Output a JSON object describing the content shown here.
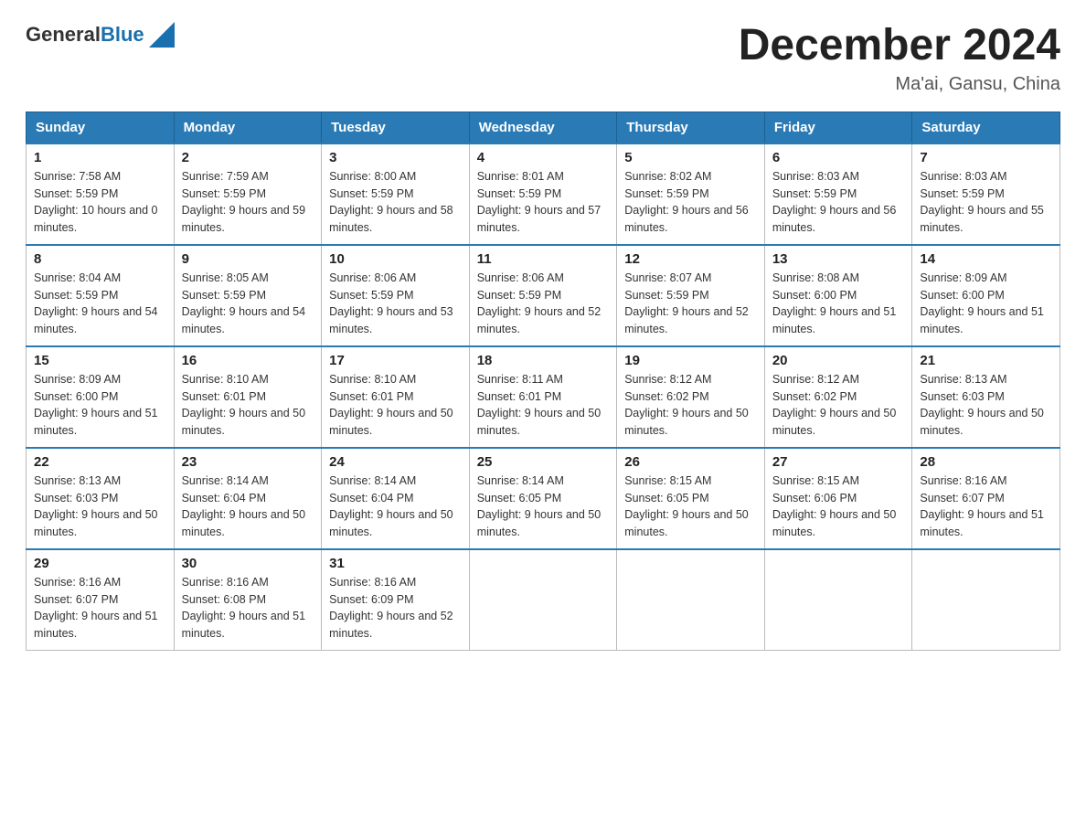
{
  "header": {
    "logo_general": "General",
    "logo_blue": "Blue",
    "month_title": "December 2024",
    "location": "Ma'ai, Gansu, China"
  },
  "days_of_week": [
    "Sunday",
    "Monday",
    "Tuesday",
    "Wednesday",
    "Thursday",
    "Friday",
    "Saturday"
  ],
  "weeks": [
    [
      {
        "day": "1",
        "sunrise": "7:58 AM",
        "sunset": "5:59 PM",
        "daylight": "10 hours and 0 minutes."
      },
      {
        "day": "2",
        "sunrise": "7:59 AM",
        "sunset": "5:59 PM",
        "daylight": "9 hours and 59 minutes."
      },
      {
        "day": "3",
        "sunrise": "8:00 AM",
        "sunset": "5:59 PM",
        "daylight": "9 hours and 58 minutes."
      },
      {
        "day": "4",
        "sunrise": "8:01 AM",
        "sunset": "5:59 PM",
        "daylight": "9 hours and 57 minutes."
      },
      {
        "day": "5",
        "sunrise": "8:02 AM",
        "sunset": "5:59 PM",
        "daylight": "9 hours and 56 minutes."
      },
      {
        "day": "6",
        "sunrise": "8:03 AM",
        "sunset": "5:59 PM",
        "daylight": "9 hours and 56 minutes."
      },
      {
        "day": "7",
        "sunrise": "8:03 AM",
        "sunset": "5:59 PM",
        "daylight": "9 hours and 55 minutes."
      }
    ],
    [
      {
        "day": "8",
        "sunrise": "8:04 AM",
        "sunset": "5:59 PM",
        "daylight": "9 hours and 54 minutes."
      },
      {
        "day": "9",
        "sunrise": "8:05 AM",
        "sunset": "5:59 PM",
        "daylight": "9 hours and 54 minutes."
      },
      {
        "day": "10",
        "sunrise": "8:06 AM",
        "sunset": "5:59 PM",
        "daylight": "9 hours and 53 minutes."
      },
      {
        "day": "11",
        "sunrise": "8:06 AM",
        "sunset": "5:59 PM",
        "daylight": "9 hours and 52 minutes."
      },
      {
        "day": "12",
        "sunrise": "8:07 AM",
        "sunset": "5:59 PM",
        "daylight": "9 hours and 52 minutes."
      },
      {
        "day": "13",
        "sunrise": "8:08 AM",
        "sunset": "6:00 PM",
        "daylight": "9 hours and 51 minutes."
      },
      {
        "day": "14",
        "sunrise": "8:09 AM",
        "sunset": "6:00 PM",
        "daylight": "9 hours and 51 minutes."
      }
    ],
    [
      {
        "day": "15",
        "sunrise": "8:09 AM",
        "sunset": "6:00 PM",
        "daylight": "9 hours and 51 minutes."
      },
      {
        "day": "16",
        "sunrise": "8:10 AM",
        "sunset": "6:01 PM",
        "daylight": "9 hours and 50 minutes."
      },
      {
        "day": "17",
        "sunrise": "8:10 AM",
        "sunset": "6:01 PM",
        "daylight": "9 hours and 50 minutes."
      },
      {
        "day": "18",
        "sunrise": "8:11 AM",
        "sunset": "6:01 PM",
        "daylight": "9 hours and 50 minutes."
      },
      {
        "day": "19",
        "sunrise": "8:12 AM",
        "sunset": "6:02 PM",
        "daylight": "9 hours and 50 minutes."
      },
      {
        "day": "20",
        "sunrise": "8:12 AM",
        "sunset": "6:02 PM",
        "daylight": "9 hours and 50 minutes."
      },
      {
        "day": "21",
        "sunrise": "8:13 AM",
        "sunset": "6:03 PM",
        "daylight": "9 hours and 50 minutes."
      }
    ],
    [
      {
        "day": "22",
        "sunrise": "8:13 AM",
        "sunset": "6:03 PM",
        "daylight": "9 hours and 50 minutes."
      },
      {
        "day": "23",
        "sunrise": "8:14 AM",
        "sunset": "6:04 PM",
        "daylight": "9 hours and 50 minutes."
      },
      {
        "day": "24",
        "sunrise": "8:14 AM",
        "sunset": "6:04 PM",
        "daylight": "9 hours and 50 minutes."
      },
      {
        "day": "25",
        "sunrise": "8:14 AM",
        "sunset": "6:05 PM",
        "daylight": "9 hours and 50 minutes."
      },
      {
        "day": "26",
        "sunrise": "8:15 AM",
        "sunset": "6:05 PM",
        "daylight": "9 hours and 50 minutes."
      },
      {
        "day": "27",
        "sunrise": "8:15 AM",
        "sunset": "6:06 PM",
        "daylight": "9 hours and 50 minutes."
      },
      {
        "day": "28",
        "sunrise": "8:16 AM",
        "sunset": "6:07 PM",
        "daylight": "9 hours and 51 minutes."
      }
    ],
    [
      {
        "day": "29",
        "sunrise": "8:16 AM",
        "sunset": "6:07 PM",
        "daylight": "9 hours and 51 minutes."
      },
      {
        "day": "30",
        "sunrise": "8:16 AM",
        "sunset": "6:08 PM",
        "daylight": "9 hours and 51 minutes."
      },
      {
        "day": "31",
        "sunrise": "8:16 AM",
        "sunset": "6:09 PM",
        "daylight": "9 hours and 52 minutes."
      },
      null,
      null,
      null,
      null
    ]
  ]
}
